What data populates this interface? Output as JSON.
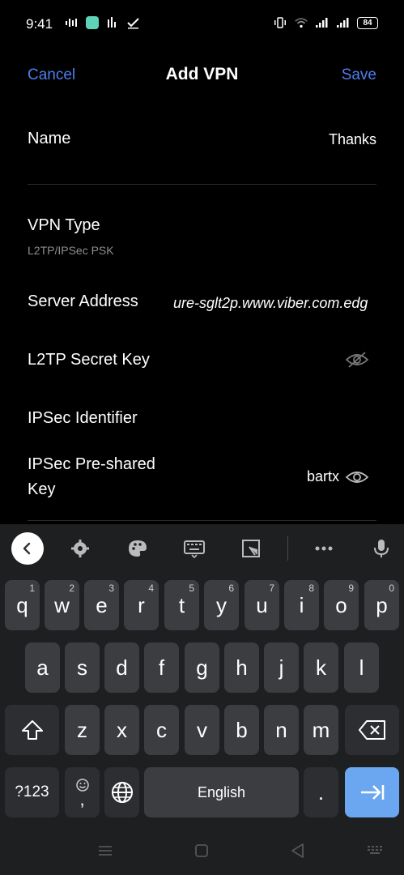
{
  "status_bar": {
    "time": "9:41",
    "battery": "84"
  },
  "header": {
    "cancel_label": "Cancel",
    "title": "Add VPN",
    "save_label": "Save"
  },
  "form": {
    "name": {
      "label": "Name",
      "value": "Thanks"
    },
    "vpn_type": {
      "label": "VPN Type",
      "value": "L2TP/IPSec PSK"
    },
    "server_address": {
      "label": "Server Address",
      "value": "ure-sglt2p.www.viber.com.edg"
    },
    "l2tp_secret": {
      "label": "L2TP Secret Key"
    },
    "ipsec_identifier": {
      "label": "IPSec Identifier"
    },
    "ipsec_psk": {
      "label_line1": "IPSec Pre-shared",
      "label_line2": "Key",
      "value": "bartx"
    }
  },
  "keyboard": {
    "row1": [
      {
        "k": "q",
        "h": "1"
      },
      {
        "k": "w",
        "h": "2"
      },
      {
        "k": "e",
        "h": "3"
      },
      {
        "k": "r",
        "h": "4"
      },
      {
        "k": "t",
        "h": "5"
      },
      {
        "k": "y",
        "h": "6"
      },
      {
        "k": "u",
        "h": "7"
      },
      {
        "k": "i",
        "h": "8"
      },
      {
        "k": "o",
        "h": "9"
      },
      {
        "k": "p",
        "h": "0"
      }
    ],
    "row2": [
      "a",
      "s",
      "d",
      "f",
      "g",
      "h",
      "j",
      "k",
      "l"
    ],
    "row3": [
      "z",
      "x",
      "c",
      "v",
      "b",
      "n",
      "m"
    ],
    "symbols_label": "?123",
    "comma": ",",
    "space_label": "English",
    "period": ".",
    "accent_color": "#6aa7f0",
    "link_color": "#4d7fef",
    "icons": [
      "back-chevron-icon",
      "settings-icon",
      "palette-icon",
      "keyboard-icon",
      "resize-icon",
      "more-icon",
      "mic-icon",
      "shift-icon",
      "backspace-icon",
      "emoji-icon",
      "globe-icon",
      "enter-icon"
    ]
  }
}
